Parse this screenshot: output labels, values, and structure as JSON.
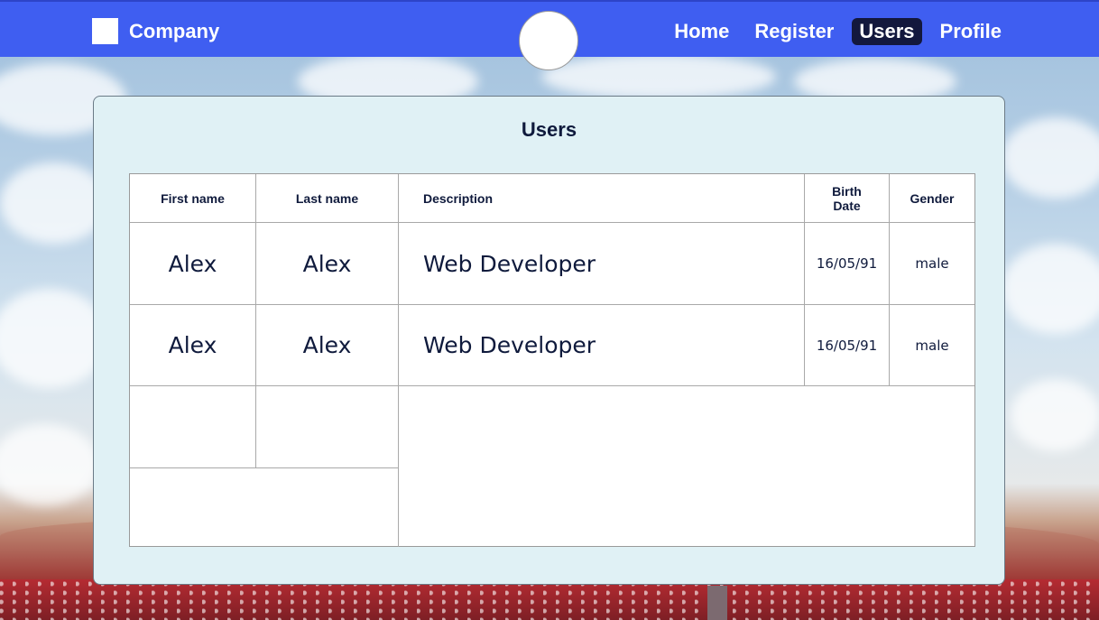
{
  "nav": {
    "brand": "Company",
    "links": [
      {
        "label": "Home",
        "active": false
      },
      {
        "label": "Register",
        "active": false
      },
      {
        "label": "Users",
        "active": true
      },
      {
        "label": "Profile",
        "active": false
      }
    ]
  },
  "panel": {
    "title": "Users",
    "table": {
      "headers": {
        "first_name": "First name",
        "last_name": "Last name",
        "description": "Description",
        "birth_date_line1": "Birth",
        "birth_date_line2": "Date",
        "gender": "Gender"
      },
      "rows": [
        {
          "first_name": "Alex",
          "last_name": "Alex",
          "description": "Web Developer",
          "birth_date": "16/05/91",
          "gender": "male"
        },
        {
          "first_name": "Alex",
          "last_name": "Alex",
          "description": "Web Developer",
          "birth_date": "16/05/91",
          "gender": "male"
        }
      ]
    }
  },
  "colors": {
    "nav_bg": "#3f5ef1",
    "active_link_bg": "#13183d",
    "panel_bg": "#e0f1f5",
    "text_dark": "#0f1a3c"
  }
}
